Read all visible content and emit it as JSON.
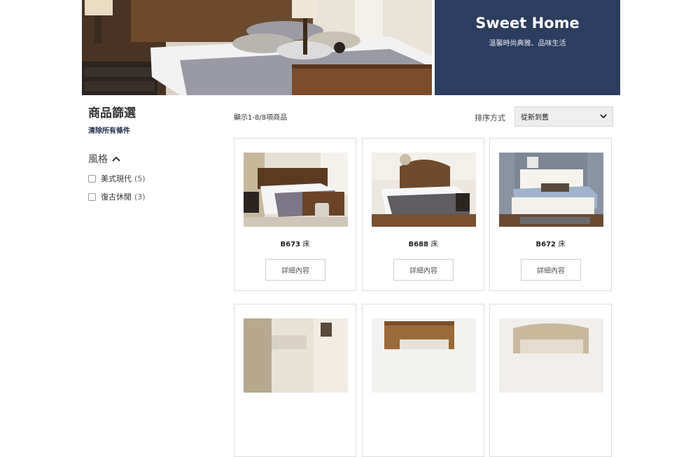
{
  "banner": {
    "title": "Sweet Home",
    "subtitle": "溫馨時尚典雅、品味生活"
  },
  "sidebar": {
    "title": "商品篩選",
    "clear": "清除所有條件",
    "style_heading": "風格",
    "options": [
      {
        "label": "美式現代",
        "count": "(5)"
      },
      {
        "label": "復古休閒",
        "count": "(3)"
      }
    ]
  },
  "toolbar": {
    "results": "顯示1-8/8項商品",
    "sort_label": "排序方式",
    "sort_value": "從新到舊"
  },
  "products": [
    {
      "code": "B673",
      "type": "床",
      "button": "詳細內容"
    },
    {
      "code": "B688",
      "type": "床",
      "button": "詳細內容"
    },
    {
      "code": "B672",
      "type": "床",
      "button": "詳細內容"
    }
  ],
  "colors": {
    "banner_panel": "#2c3e5f",
    "accent_text": "#1f2d4a"
  }
}
